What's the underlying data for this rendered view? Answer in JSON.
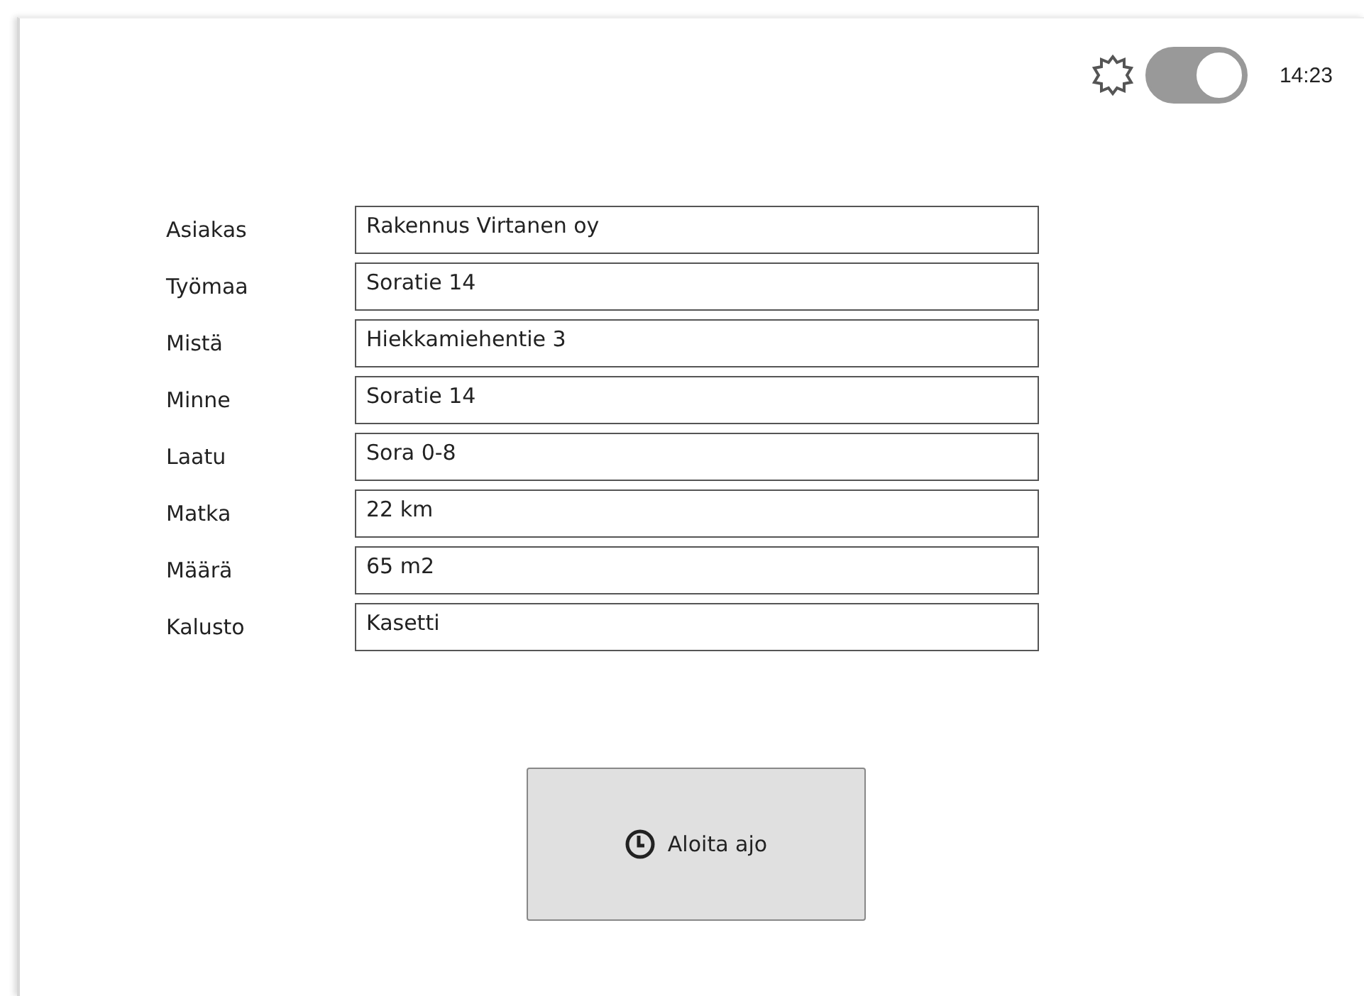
{
  "header": {
    "theme_toggle": {
      "on": true
    },
    "time": "14:23"
  },
  "form": {
    "fields": [
      {
        "label": "Asiakas",
        "value": "Rakennus Virtanen oy"
      },
      {
        "label": "Työmaa",
        "value": "Soratie 14"
      },
      {
        "label": "Mistä",
        "value": "Hiekkamiehentie 3"
      },
      {
        "label": "Minne",
        "value": "Soratie 14"
      },
      {
        "label": "Laatu",
        "value": "Sora 0-8"
      },
      {
        "label": "Matka",
        "value": "22 km"
      },
      {
        "label": "Määrä",
        "value": "65 m2"
      },
      {
        "label": "Kalusto",
        "value": "Kasetti"
      }
    ]
  },
  "start_button": {
    "label": "Aloita ajo"
  }
}
